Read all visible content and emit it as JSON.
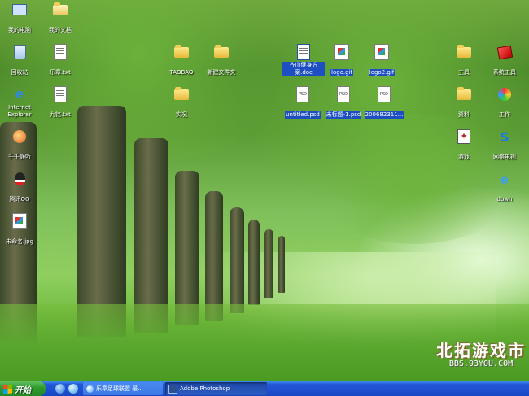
{
  "desktop_icons": {
    "my_computer": {
      "label": "我的电脑",
      "icon": "my-computer-icon"
    },
    "my_documents": {
      "label": "我的文档",
      "icon": "my-documents-icon"
    },
    "recycle_bin": {
      "label": "回收站",
      "icon": "recycle-bin-icon"
    },
    "le_zhang_txt": {
      "label": "乐章.txt",
      "icon": "text-file-icon"
    },
    "taobao": {
      "label": "TAOBAO",
      "icon": "folder-icon"
    },
    "new_folder": {
      "label": "新建文件夹",
      "icon": "folder-icon"
    },
    "doc_file": {
      "label": "齐山健身方案.doc",
      "icon": "word-document-icon"
    },
    "logo_gif": {
      "label": "logo.gif",
      "icon": "image-file-icon"
    },
    "logo2_gif": {
      "label": "logo2.gif",
      "icon": "image-file-icon"
    },
    "tools": {
      "label": "工具",
      "icon": "folder-icon"
    },
    "system_tools": {
      "label": "系统工具",
      "icon": "system-tools-icon"
    },
    "ie": {
      "label": "Internet Explorer",
      "icon": "internet-explorer-icon"
    },
    "jiu_ming_txt": {
      "label": "九铭.txt",
      "icon": "text-file-icon"
    },
    "shi_kuang": {
      "label": "实况",
      "icon": "folder-icon"
    },
    "untitled_psd": {
      "label": "untitled.psd",
      "icon": "psd-file-icon"
    },
    "wei_biao_ti_psd": {
      "label": "未标题-1.psd",
      "icon": "psd-file-icon"
    },
    "psd_2006": {
      "label": "200682311...",
      "icon": "psd-file-icon"
    },
    "materials": {
      "label": "资料",
      "icon": "folder-icon"
    },
    "work": {
      "label": "工作",
      "icon": "work-icon"
    },
    "ttplayer": {
      "label": "千千静听",
      "icon": "ttplayer-icon"
    },
    "games": {
      "label": "游戏",
      "icon": "game-icon"
    },
    "network_tv": {
      "label": "网络电视",
      "icon": "network-tv-icon"
    },
    "qq": {
      "label": "腾讯QQ",
      "icon": "qq-icon"
    },
    "down": {
      "label": "down",
      "icon": "download-icon"
    },
    "wei_ming_ming_jpg": {
      "label": "未命名.jpg",
      "icon": "jpg-file-icon"
    }
  },
  "taskbar": {
    "start_label": "开始",
    "tasks": [
      {
        "label": "乐章足球联盟 最...",
        "icon": "ie-page-icon"
      },
      {
        "label": "Adobe Photoshop",
        "icon": "photoshop-icon"
      }
    ]
  },
  "watermark": {
    "line1": "北拓游戏市",
    "line2": "BBS.93YOU.COM"
  },
  "colors": {
    "taskbar_blue": "#2257d6",
    "start_green": "#2f9a2f",
    "selection_blue": "#1d4fc3"
  }
}
